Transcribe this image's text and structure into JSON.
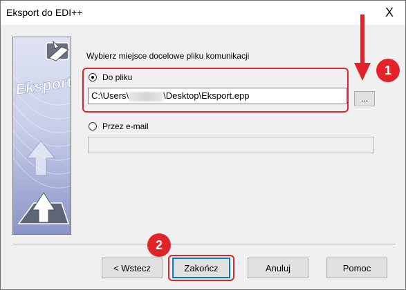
{
  "window": {
    "title": "Eksport do EDI++",
    "close_glyph": "X"
  },
  "sidebar": {
    "logo_text": "Eksport"
  },
  "main": {
    "prompt": "Wybierz miejsce docelowe pliku komunikacji",
    "option_file": {
      "label": "Do pliku",
      "checked": true
    },
    "file_path": {
      "prefix": "C:\\Users\\",
      "suffix": "\\Desktop\\Eksport.epp"
    },
    "browse_label": "...",
    "option_email": {
      "label": "Przez e-mail",
      "checked": false
    },
    "email_value": ""
  },
  "annotations": {
    "badge_1": "1",
    "badge_2": "2",
    "accent_color": "#e2242a"
  },
  "buttons": {
    "back": "< Wstecz",
    "finish": "Zakończ",
    "cancel": "Anuluj",
    "help": "Pomoc"
  }
}
